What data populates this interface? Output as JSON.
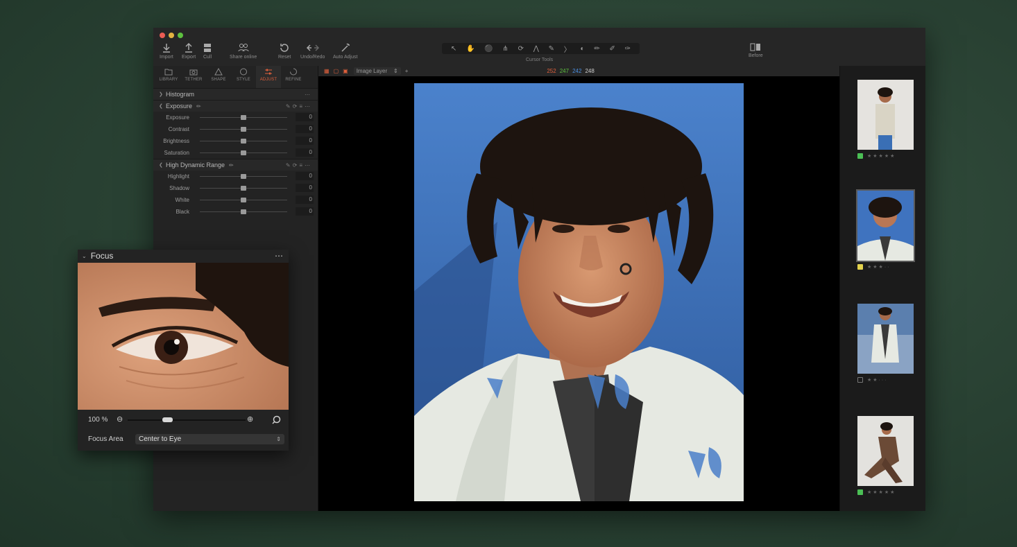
{
  "colors": {
    "accent": "#e0603c",
    "close": "#ec5c54",
    "minimize": "#e2b241",
    "zoom": "#5dc03f"
  },
  "toolbar": {
    "import": "Import",
    "export": "Export",
    "cull": "Cull",
    "share": "Share online",
    "reset": "Reset",
    "undo_redo": "Undo/Redo",
    "auto_adjust": "Auto Adjust",
    "cursor_tools": "Cursor Tools",
    "before": "Before"
  },
  "subbar": {
    "layer": "Image Layer",
    "rgb": [
      "252",
      "247",
      "242",
      "248"
    ]
  },
  "tabs": [
    "LIBRARY",
    "TETHER",
    "SHAPE",
    "STYLE",
    "ADJUST",
    "REFINE"
  ],
  "sections": {
    "histogram": "Histogram",
    "exposure": {
      "title": "Exposure",
      "rows": [
        {
          "label": "Exposure",
          "value": "0"
        },
        {
          "label": "Contrast",
          "value": "0"
        },
        {
          "label": "Brightness",
          "value": "0"
        },
        {
          "label": "Saturation",
          "value": "0"
        }
      ]
    },
    "hdr": {
      "title": "High Dynamic Range",
      "rows": [
        {
          "label": "Highlight",
          "value": "0"
        },
        {
          "label": "Shadow",
          "value": "0"
        },
        {
          "label": "White",
          "value": "0"
        },
        {
          "label": "Black",
          "value": "0"
        }
      ]
    }
  },
  "focus": {
    "title": "Focus",
    "zoom": "100 %",
    "area_label": "Focus Area",
    "area_value": "Center to Eye"
  },
  "filmstrip": [
    {
      "tag": "green",
      "stars": 5
    },
    {
      "tag": "yellow",
      "stars": 3
    },
    {
      "tag": "none",
      "stars": 2
    },
    {
      "tag": "green",
      "stars": 5
    }
  ]
}
